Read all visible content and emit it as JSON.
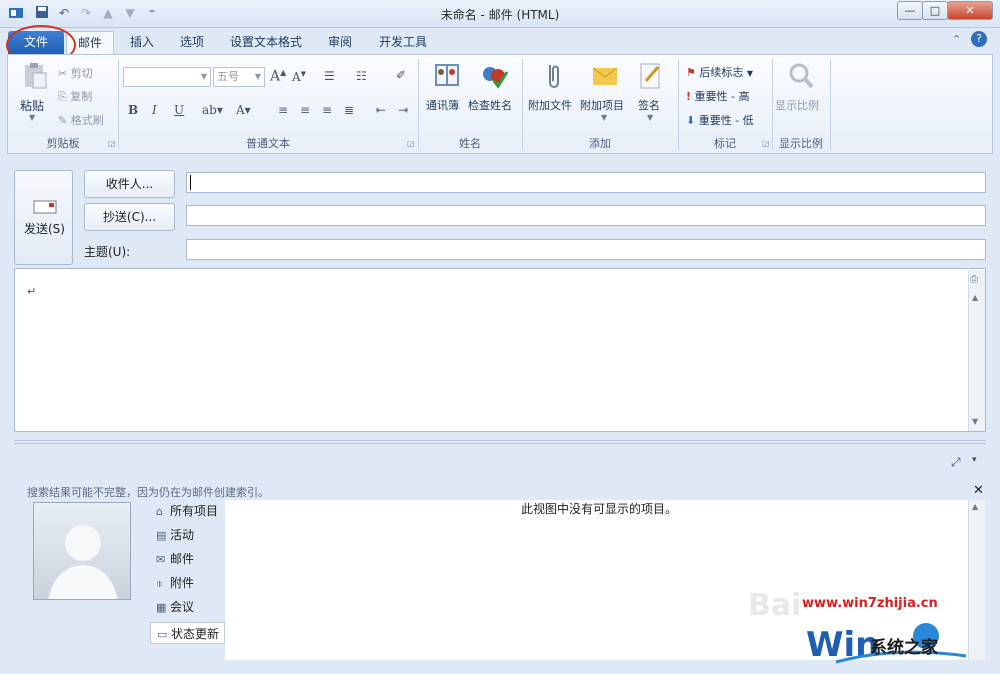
{
  "window": {
    "title": "未命名 - 邮件 (HTML)",
    "controls": {
      "minimize": "—",
      "maximize": "□",
      "close": "✕"
    }
  },
  "qat": {
    "icons": [
      "outlook-icon",
      "save-icon",
      "undo-icon",
      "redo-icon",
      "up-icon",
      "down-icon",
      "customize-icon"
    ]
  },
  "tabs": [
    {
      "label": "文件"
    },
    {
      "label": "邮件"
    },
    {
      "label": "插入"
    },
    {
      "label": "选项"
    },
    {
      "label": "设置文本格式"
    },
    {
      "label": "审阅"
    },
    {
      "label": "开发工具"
    }
  ],
  "ribbon": {
    "clipboard": {
      "label": "剪贴板",
      "paste": "粘贴",
      "cut": "剪切",
      "copy": "复制",
      "format_painter": "格式刷"
    },
    "basic_text": {
      "label": "普通文本",
      "font_size": "五号"
    },
    "names": {
      "label": "姓名",
      "address_book": "通讯簿",
      "check_names": "检查姓名"
    },
    "include": {
      "label": "添加",
      "attach_file": "附加文件",
      "attach_item": "附加项目",
      "signature": "签名"
    },
    "tags": {
      "label": "标记",
      "follow_up": "后续标志",
      "high_importance": "重要性 - 高",
      "low_importance": "重要性 - 低"
    },
    "zoom": {
      "label": "显示比例",
      "zoom_btn": "显示比例"
    }
  },
  "compose": {
    "send": "发送(S)",
    "to_button": "收件人...",
    "cc_button": "抄送(C)...",
    "subject_label": "主题(U):",
    "to_value": "",
    "cc_value": "",
    "subject_value": "",
    "body_mark": "↵"
  },
  "people_pane": {
    "notice": "搜索结果可能不完整，因为仍在为邮件创建索引。",
    "empty_message": "此视图中没有可显示的项目。",
    "nav": [
      {
        "label": "所有项目",
        "icon": "⌂"
      },
      {
        "label": "活动",
        "icon": "▤"
      },
      {
        "label": "邮件",
        "icon": "✉"
      },
      {
        "label": "附件",
        "icon": "⌽"
      },
      {
        "label": "会议",
        "icon": "▦"
      },
      {
        "label": "状态更新",
        "icon": "▭"
      }
    ]
  },
  "watermark": {
    "url": "www.win7zhijia.cn",
    "name": "系统之家",
    "logo_text": "Win7",
    "baidu": "Bai"
  }
}
